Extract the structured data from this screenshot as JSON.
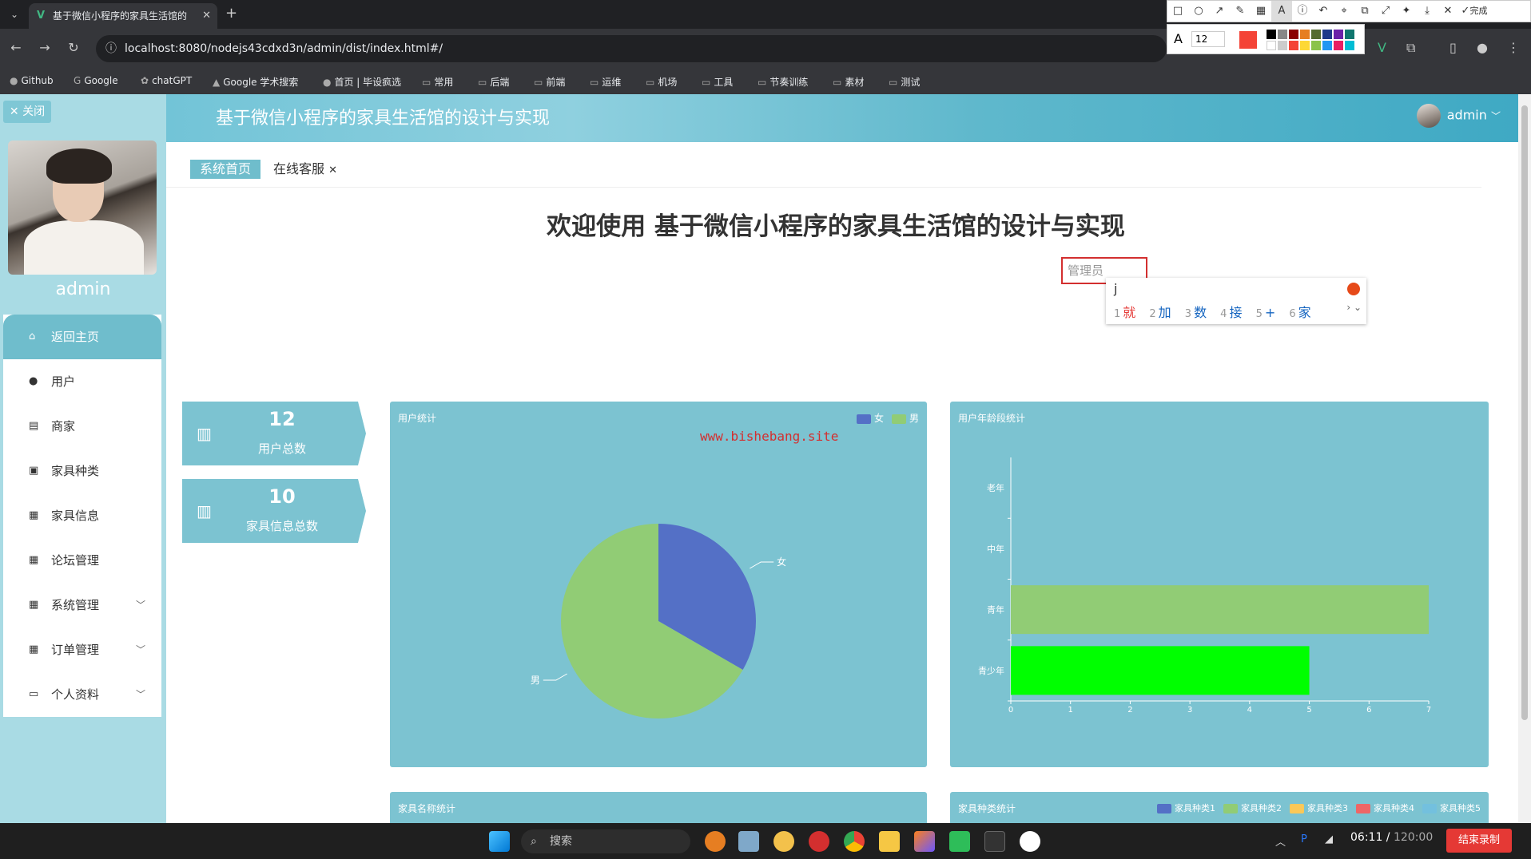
{
  "browser": {
    "tab_title": "基于微信小程序的家具生活馆的",
    "url": "localhost:8080/nodejs43cdxd3n/admin/dist/index.html#/",
    "bookmarks": [
      "Github",
      "Google",
      "chatGPT",
      "Google 学术搜索",
      "首页 | 毕设疯选",
      "常用",
      "后端",
      "前端",
      "运维",
      "机场",
      "工具",
      "节奏训练",
      "素材",
      "测试"
    ]
  },
  "annotation_toolbar": {
    "done_label": "完成",
    "font_size": "12"
  },
  "sidebar": {
    "close_label": "关闭",
    "username": "admin",
    "menu": [
      {
        "label": "返回主页",
        "icon": "home-icon",
        "active": true
      },
      {
        "label": "用户",
        "icon": "user-icon"
      },
      {
        "label": "商家",
        "icon": "store-icon"
      },
      {
        "label": "家具种类",
        "icon": "category-icon"
      },
      {
        "label": "家具信息",
        "icon": "grid-icon"
      },
      {
        "label": "论坛管理",
        "icon": "grid-icon"
      },
      {
        "label": "系统管理",
        "icon": "grid-icon",
        "expandable": true
      },
      {
        "label": "订单管理",
        "icon": "grid-icon",
        "expandable": true
      },
      {
        "label": "个人资料",
        "icon": "card-icon",
        "expandable": true
      }
    ]
  },
  "header": {
    "title": "基于微信小程序的家具生活馆的设计与实现",
    "user": "admin"
  },
  "tags": {
    "home": "系统首页",
    "service": "在线客服"
  },
  "welcome": "欢迎使用 基于微信小程序的家具生活馆的设计与实现",
  "ime": {
    "field_value": "管理员",
    "typed": "j",
    "candidates": [
      {
        "n": "1",
        "text": "就"
      },
      {
        "n": "2",
        "text": "加"
      },
      {
        "n": "3",
        "text": "数"
      },
      {
        "n": "4",
        "text": "接"
      },
      {
        "n": "5",
        "text": "+"
      },
      {
        "n": "6",
        "text": "家"
      }
    ]
  },
  "stats": [
    {
      "value": "12",
      "label": "用户总数"
    },
    {
      "value": "10",
      "label": "家具信息总数"
    }
  ],
  "watermark": "www.bishebang.site",
  "charts": {
    "user_stats_title": "用户统计",
    "age_stats_title": "用户年龄段统计",
    "furniture_name_title": "家具名称统计",
    "furniture_type_title": "家具种类统计"
  },
  "chart_data": [
    {
      "type": "pie",
      "title": "用户统计",
      "categories": [
        "女",
        "男"
      ],
      "values": [
        4,
        8
      ],
      "colors": [
        "#5470c6",
        "#91cc75"
      ]
    },
    {
      "type": "bar",
      "orientation": "horizontal",
      "title": "用户年龄段统计",
      "categories": [
        "青少年",
        "青年",
        "中年",
        "老年"
      ],
      "values": [
        5,
        7,
        0,
        0
      ],
      "colors": [
        "#00ff00",
        "#91cc75"
      ],
      "xlim": [
        0,
        7
      ],
      "xticks": [
        0,
        1,
        2,
        3,
        4,
        5,
        6,
        7
      ]
    },
    {
      "type": "bar",
      "title": "家具名称统计"
    },
    {
      "type": "bar",
      "title": "家具种类统计",
      "legend": [
        "家具种类1",
        "家具种类2",
        "家具种类3",
        "家具种类4",
        "家具种类5"
      ],
      "colors": [
        "#5470c6",
        "#91cc75",
        "#fac858",
        "#ee6666",
        "#73c0de"
      ]
    }
  ],
  "taskbar": {
    "search_label": "搜索",
    "rec_elapsed": "06:11",
    "rec_total": "120:00",
    "stop_label": "结束录制"
  }
}
